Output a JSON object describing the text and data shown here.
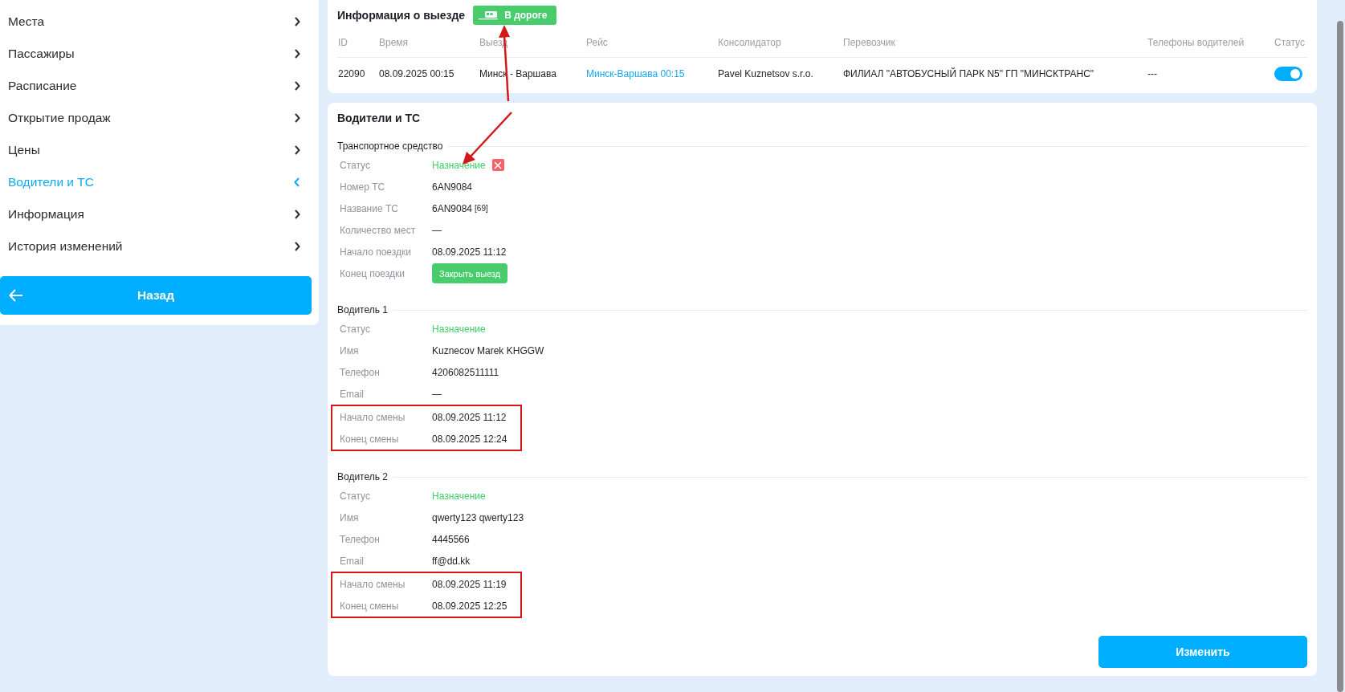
{
  "sidebar": {
    "items": [
      {
        "label": "Места",
        "selected": false
      },
      {
        "label": "Пассажиры",
        "selected": false
      },
      {
        "label": "Расписание",
        "selected": false
      },
      {
        "label": "Открытие продаж",
        "selected": false
      },
      {
        "label": "Цены",
        "selected": false
      },
      {
        "label": "Водители и ТС",
        "selected": true
      },
      {
        "label": "Информация",
        "selected": false
      },
      {
        "label": "История изменений",
        "selected": false
      }
    ],
    "back_button": {
      "label": "Назад"
    }
  },
  "trip_info": {
    "title": "Информация о выезде",
    "status_badge": {
      "label": "В дороге"
    },
    "columns": [
      "ID",
      "Время",
      "Выезд",
      "Рейс",
      "Консолидатор",
      "Перевозчик",
      "Телефоны водителей",
      "Статус"
    ],
    "rows": [
      {
        "id": "22090",
        "time": "08.09.2025 00:15",
        "departure": "Минск - Варшава",
        "route": "Минск-Варшава 00:15",
        "consolidator": "Pavel Kuznetsov s.r.o.",
        "carrier": "ФИЛИАЛ \"АВТОБУСНЫЙ ПАРК N5\" ГП \"МИНСКТРАНС\"",
        "driver_phones": "---",
        "status_on": true
      }
    ]
  },
  "drivers_card": {
    "title": "Водители и ТС",
    "sections": [
      {
        "title": "Транспортное средство",
        "fields": [
          {
            "kind": "status_removable",
            "label": "Статус",
            "value": "Назначение",
            "highlighted": false
          },
          {
            "kind": "text",
            "label": "Номер ТС",
            "value": "6AN9084",
            "highlighted": false
          },
          {
            "kind": "text_note",
            "label": "Название ТС",
            "value": "6AN9084",
            "note": "[69]",
            "highlighted": false
          },
          {
            "kind": "text",
            "label": "Количество мест",
            "value": "—",
            "highlighted": false
          },
          {
            "kind": "text",
            "label": "Начало поездки",
            "value": "08.09.2025 11:12",
            "highlighted": false
          },
          {
            "kind": "button",
            "label": "Конец поездки",
            "value": "Закрыть выезд",
            "highlighted": false
          }
        ]
      },
      {
        "title": "Водитель 1",
        "fields": [
          {
            "kind": "status",
            "label": "Статус",
            "value": "Назначение",
            "highlighted": false
          },
          {
            "kind": "text",
            "label": "Имя",
            "value": "Kuznecov Marek KHGGW",
            "highlighted": false
          },
          {
            "kind": "text",
            "label": "Телефон",
            "value": "4206082511111",
            "highlighted": false
          },
          {
            "kind": "text",
            "label": "Email",
            "value": "—",
            "highlighted": false
          },
          {
            "kind": "text",
            "label": "Начало смены",
            "value": "08.09.2025 11:12",
            "highlighted": true
          },
          {
            "kind": "text",
            "label": "Конец смены",
            "value": "08.09.2025 12:24",
            "highlighted": true
          }
        ]
      },
      {
        "title": "Водитель 2",
        "fields": [
          {
            "kind": "status",
            "label": "Статус",
            "value": "Назначение",
            "highlighted": false
          },
          {
            "kind": "text",
            "label": "Имя",
            "value": "qwerty123 qwerty123",
            "highlighted": false
          },
          {
            "kind": "text",
            "label": "Телефон",
            "value": "4445566",
            "highlighted": false
          },
          {
            "kind": "text",
            "label": "Email",
            "value": "ff@dd.kk",
            "highlighted": false
          },
          {
            "kind": "text",
            "label": "Начало смены",
            "value": "08.09.2025 11:19",
            "highlighted": true
          },
          {
            "kind": "text",
            "label": "Конец смены",
            "value": "08.09.2025 12:25",
            "highlighted": true
          }
        ]
      }
    ],
    "edit_button": {
      "label": "Изменить"
    }
  }
}
